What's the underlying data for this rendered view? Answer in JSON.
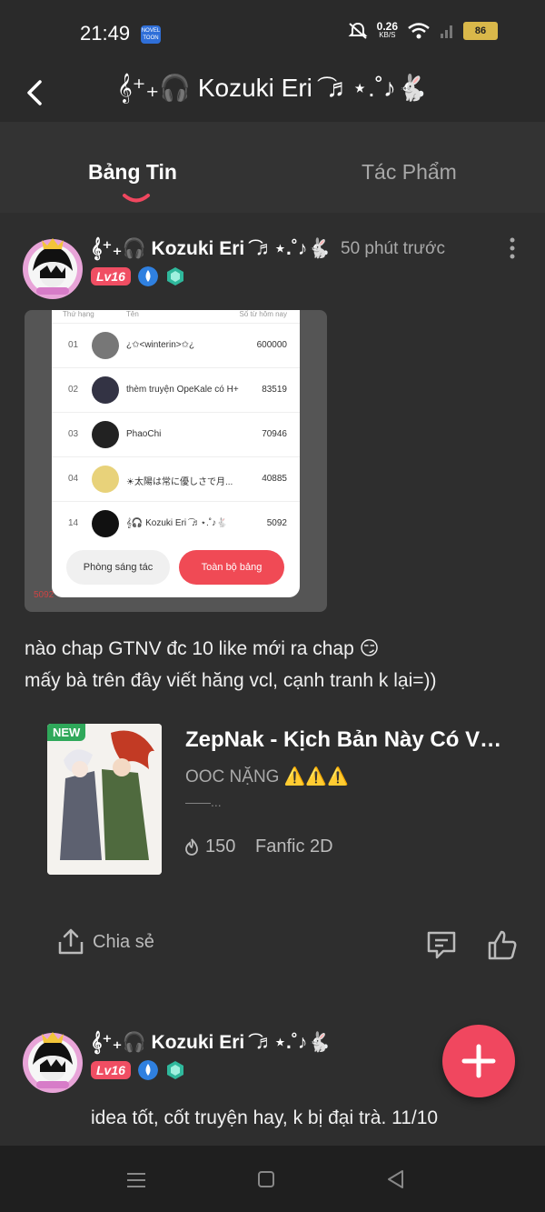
{
  "status": {
    "time": "21:49",
    "novel_badge": "NOVEL TOON",
    "net_speed": "0.26",
    "net_unit": "KB/S",
    "battery": "86"
  },
  "header": {
    "title": "𝄞⁺₊🎧 Kozuki Eri ͡ ♬⋆.˚♪🐇"
  },
  "tabs": [
    {
      "label": "Bảng Tin"
    },
    {
      "label": "Tác Phẩm"
    }
  ],
  "post": {
    "author": "𝄞⁺₊🎧 Kozuki Eri ͡ ♬⋆.˚♪🐇",
    "time": "50 phút trước",
    "level": "Lv16",
    "screenshot": {
      "headers": [
        "Thứ hạng",
        "Tên",
        "Số từ hôm nay"
      ],
      "rows": [
        {
          "rank": "01",
          "name": "¿✩<winterin>✩¿",
          "value": "600000"
        },
        {
          "rank": "02",
          "name": "thèm truyện OpeKale có H+",
          "value": "83519"
        },
        {
          "rank": "03",
          "name": "PhaoChi",
          "value": "70946"
        },
        {
          "rank": "04",
          "name": "☀太陽は常に優しさで月...",
          "value": "40885"
        },
        {
          "rank": "14",
          "name": "𝄞🎧 Kozuki Eri ͡ ♬⋆.˚♪🐇",
          "value": "5092"
        }
      ],
      "btn_left": "Phòng sáng tác",
      "btn_right": "Toàn bộ bảng",
      "corner_value": "5092"
    },
    "text_line1": "nào chap GTNV đc 10 like mới ra chap 😏",
    "text_line2": "mấy bà trên đây viết hăng vcl, cạnh tranh k lại=))",
    "book": {
      "badge": "NEW",
      "title": "ZepNak - Kịch Bản Này Có Vấn Đề",
      "tag": "OOC NẶNG ⚠️⚠️⚠️",
      "desc": "——...",
      "reads": "150",
      "genre": "Fanfic 2D"
    },
    "share_label": "Chia sẻ"
  },
  "post2": {
    "author": "𝄞⁺₊🎧 Kozuki Eri ͡ ♬⋆.˚♪🐇",
    "level": "Lv16",
    "text": "idea tốt, cốt truyện hay, k bị đại trà. 11/10"
  },
  "colors": {
    "accent": "#f0475f",
    "background": "#2e2e2e"
  }
}
